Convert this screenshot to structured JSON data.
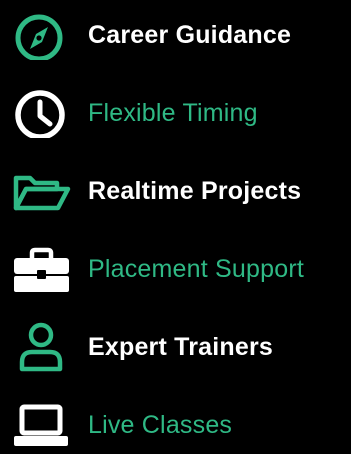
{
  "colors": {
    "accent": "#2fb985",
    "text_primary": "#ffffff",
    "background": "#000000"
  },
  "features": [
    {
      "icon": "compass-icon",
      "label": "Career Guidance",
      "highlight": false
    },
    {
      "icon": "clock-icon",
      "label": "Flexible Timing",
      "highlight": true
    },
    {
      "icon": "folder-icon",
      "label": "Realtime Projects",
      "highlight": false
    },
    {
      "icon": "briefcase-icon",
      "label": "Placement Support",
      "highlight": true
    },
    {
      "icon": "user-icon",
      "label": "Expert Trainers",
      "highlight": false
    },
    {
      "icon": "laptop-icon",
      "label": "Live Classes",
      "highlight": true
    }
  ]
}
